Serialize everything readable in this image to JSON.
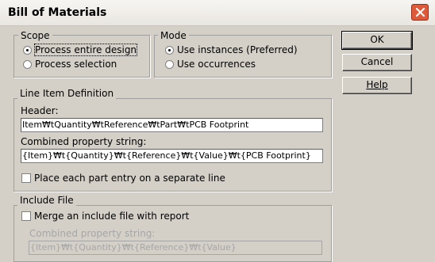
{
  "window": {
    "title": "Bill of Materials",
    "close_icon": "close-icon"
  },
  "colors": {
    "dialog_bg": "#d4d0c8",
    "close_button": "#df5a3b",
    "disabled_text": "#a6a6a6"
  },
  "scope": {
    "label": "Scope",
    "options": [
      {
        "label": "Process entire design",
        "checked": true
      },
      {
        "label": "Process selection",
        "checked": false
      }
    ]
  },
  "mode": {
    "label": "Mode",
    "options": [
      {
        "label": "Use instances (Preferred)",
        "checked": true
      },
      {
        "label": "Use occurrences",
        "checked": false
      }
    ]
  },
  "buttons": {
    "ok": "OK",
    "cancel": "Cancel",
    "help": "Help"
  },
  "line_item": {
    "label": "Line Item Definition",
    "header_label": "Header:",
    "header_value": "Item₩tQuantity₩tReference₩tPart₩tPCB Footprint",
    "combined_label": "Combined property string:",
    "combined_value": "{Item}₩t{Quantity}₩t{Reference}₩t{Value}₩t{PCB Footprint}",
    "separate_line_label": "Place each part entry on a separate line",
    "separate_line_checked": false
  },
  "include_file": {
    "label": "Include File",
    "merge_label": "Merge an include file with report",
    "merge_checked": false,
    "combined_label": "Combined property string:",
    "combined_value": "{Item}₩t{Quantity}₩t{Reference}₩t{Value}"
  }
}
